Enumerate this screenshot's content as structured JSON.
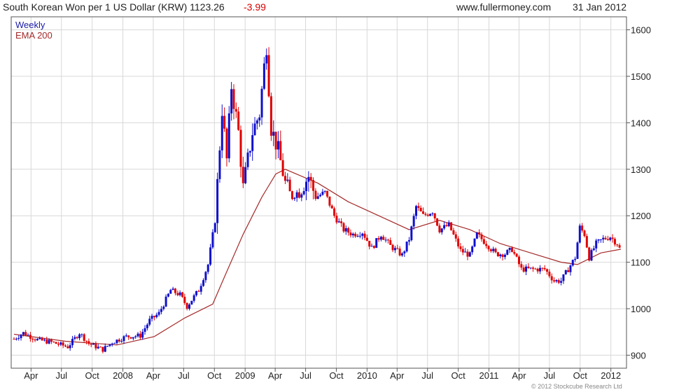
{
  "header": {
    "title": "South Korean Won per 1 US Dollar (KRW) 1123.26",
    "change": "-3.99",
    "site": "www.fullermoney.com",
    "date": "31 Jan 2012"
  },
  "legend": {
    "series": "Weekly",
    "indicator": "EMA 200"
  },
  "copyright": "© 2012 Stockcube Research Ltd",
  "colors": {
    "up": "#1010cc",
    "down": "#e00000",
    "ema": "#a52a2a",
    "grid": "#d8d8d8",
    "frame": "#555555"
  },
  "chart_data": {
    "type": "candlestick",
    "title": "South Korean Won per 1 US Dollar (KRW) 1123.26 -3.99",
    "frequency": "Weekly",
    "date_range": [
      "2007-02-09",
      "2012-01-31"
    ],
    "ylim": [
      872,
      1628
    ],
    "y_ticks": [
      900,
      1000,
      1100,
      1200,
      1300,
      1400,
      1500,
      1600
    ],
    "x_tick_labels": [
      {
        "date": "2007-04-01",
        "label": "Apr"
      },
      {
        "date": "2007-07-01",
        "label": "Jul"
      },
      {
        "date": "2007-10-01",
        "label": "Oct"
      },
      {
        "date": "2008-01-01",
        "label": "2008"
      },
      {
        "date": "2008-04-01",
        "label": "Apr"
      },
      {
        "date": "2008-07-01",
        "label": "Jul"
      },
      {
        "date": "2008-10-01",
        "label": "Oct"
      },
      {
        "date": "2009-01-01",
        "label": "2009"
      },
      {
        "date": "2009-04-01",
        "label": "Apr"
      },
      {
        "date": "2009-07-01",
        "label": "Jul"
      },
      {
        "date": "2009-10-01",
        "label": "Oct"
      },
      {
        "date": "2010-01-01",
        "label": "2010"
      },
      {
        "date": "2010-04-01",
        "label": "Apr"
      },
      {
        "date": "2010-07-01",
        "label": "Jul"
      },
      {
        "date": "2010-10-01",
        "label": "Oct"
      },
      {
        "date": "2011-01-01",
        "label": "2011"
      },
      {
        "date": "2011-04-01",
        "label": "Apr"
      },
      {
        "date": "2011-07-01",
        "label": "Jul"
      },
      {
        "date": "2011-10-01",
        "label": "Oct"
      },
      {
        "date": "2012-01-01",
        "label": "2012"
      }
    ],
    "close_path": [
      [
        "2007-02-09",
        935
      ],
      [
        "2007-03-09",
        948
      ],
      [
        "2007-04-20",
        933
      ],
      [
        "2007-06-01",
        928
      ],
      [
        "2007-07-20",
        918
      ],
      [
        "2007-08-24",
        948
      ],
      [
        "2007-09-21",
        925
      ],
      [
        "2007-11-02",
        912
      ],
      [
        "2007-11-30",
        928
      ],
      [
        "2008-01-11",
        940
      ],
      [
        "2008-02-22",
        942
      ],
      [
        "2008-03-21",
        975
      ],
      [
        "2008-04-18",
        990
      ],
      [
        "2008-05-23",
        1040
      ],
      [
        "2008-06-20",
        1030
      ],
      [
        "2008-07-11",
        1005
      ],
      [
        "2008-08-15",
        1040
      ],
      [
        "2008-09-12",
        1095
      ],
      [
        "2008-10-03",
        1190
      ],
      [
        "2008-10-24",
        1430
      ],
      [
        "2008-11-07",
        1320
      ],
      [
        "2008-11-21",
        1480
      ],
      [
        "2008-12-12",
        1380
      ],
      [
        "2008-12-26",
        1260
      ],
      [
        "2009-01-23",
        1380
      ],
      [
        "2009-02-13",
        1420
      ],
      [
        "2009-03-06",
        1570
      ],
      [
        "2009-03-20",
        1390
      ],
      [
        "2009-04-10",
        1340
      ],
      [
        "2009-05-01",
        1270
      ],
      [
        "2009-05-22",
        1240
      ],
      [
        "2009-06-19",
        1260
      ],
      [
        "2009-07-10",
        1285
      ],
      [
        "2009-07-31",
        1240
      ],
      [
        "2009-08-28",
        1250
      ],
      [
        "2009-09-25",
        1200
      ],
      [
        "2009-10-23",
        1170
      ],
      [
        "2009-11-20",
        1160
      ],
      [
        "2009-12-18",
        1165
      ],
      [
        "2010-01-15",
        1130
      ],
      [
        "2010-02-12",
        1160
      ],
      [
        "2010-03-12",
        1135
      ],
      [
        "2010-04-16",
        1115
      ],
      [
        "2010-05-07",
        1150
      ],
      [
        "2010-05-28",
        1220
      ],
      [
        "2010-06-18",
        1200
      ],
      [
        "2010-07-16",
        1210
      ],
      [
        "2010-08-06",
        1170
      ],
      [
        "2010-09-03",
        1180
      ],
      [
        "2010-10-08",
        1125
      ],
      [
        "2010-11-05",
        1115
      ],
      [
        "2010-11-26",
        1160
      ],
      [
        "2010-12-24",
        1140
      ],
      [
        "2011-01-21",
        1118
      ],
      [
        "2011-02-18",
        1118
      ],
      [
        "2011-03-11",
        1128
      ],
      [
        "2011-04-08",
        1085
      ],
      [
        "2011-05-13",
        1085
      ],
      [
        "2011-06-17",
        1085
      ],
      [
        "2011-07-15",
        1060
      ],
      [
        "2011-08-05",
        1060
      ],
      [
        "2011-08-26",
        1085
      ],
      [
        "2011-09-16",
        1110
      ],
      [
        "2011-09-30",
        1175
      ],
      [
        "2011-10-14",
        1160
      ],
      [
        "2011-10-28",
        1110
      ],
      [
        "2011-11-18",
        1140
      ],
      [
        "2011-12-09",
        1150
      ],
      [
        "2011-12-30",
        1155
      ],
      [
        "2012-01-20",
        1140
      ],
      [
        "2012-01-31",
        1123.26
      ]
    ],
    "ema_path": [
      [
        "2007-02-09",
        945
      ],
      [
        "2007-07-13",
        930
      ],
      [
        "2007-12-14",
        922
      ],
      [
        "2008-04-04",
        940
      ],
      [
        "2008-07-04",
        980
      ],
      [
        "2008-09-26",
        1010
      ],
      [
        "2008-11-07",
        1080
      ],
      [
        "2008-12-26",
        1160
      ],
      [
        "2009-02-20",
        1240
      ],
      [
        "2009-04-03",
        1290
      ],
      [
        "2009-05-01",
        1300
      ],
      [
        "2009-08-07",
        1270
      ],
      [
        "2009-11-06",
        1230
      ],
      [
        "2010-02-05",
        1200
      ],
      [
        "2010-05-07",
        1170
      ],
      [
        "2010-08-06",
        1190
      ],
      [
        "2010-11-05",
        1170
      ],
      [
        "2011-02-04",
        1140
      ],
      [
        "2011-05-06",
        1120
      ],
      [
        "2011-08-05",
        1100
      ],
      [
        "2011-09-23",
        1095
      ],
      [
        "2011-12-02",
        1120
      ],
      [
        "2012-01-31",
        1128
      ]
    ]
  }
}
